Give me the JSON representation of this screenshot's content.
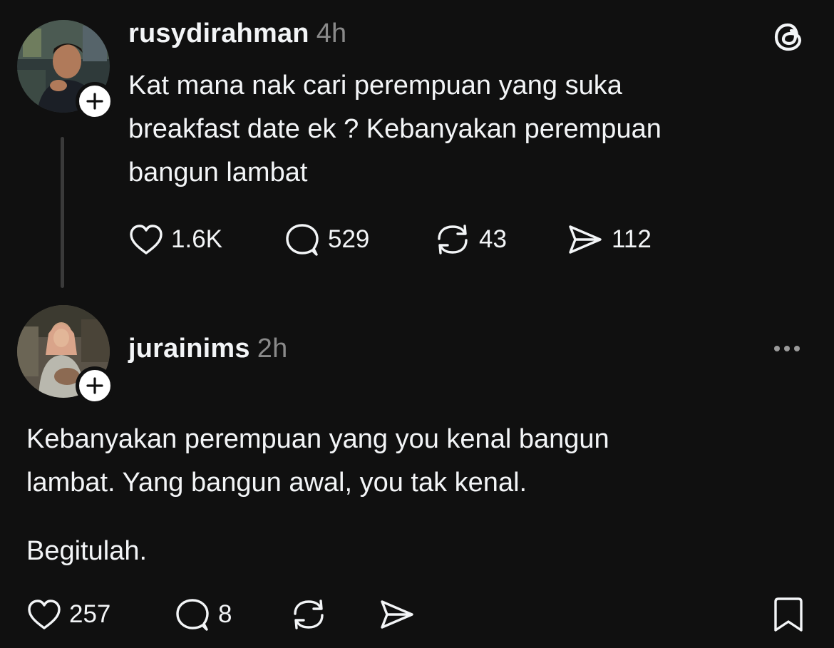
{
  "post1": {
    "username": "rusydirahman",
    "time": "4h",
    "text": "Kat mana nak cari perempuan yang suka\nbreakfast date ek ? Kebanyakan perempuan\nbangun lambat",
    "likes": "1.6K",
    "replies": "529",
    "reposts": "43",
    "shares": "112"
  },
  "post2": {
    "username": "jurainims",
    "time": "2h",
    "text": "Kebanyakan perempuan yang you kenal bangun\nlambat. Yang bangun awal, you tak kenal.",
    "text2": "Begitulah.",
    "likes": "257",
    "replies": "8"
  },
  "icons": {
    "logo": "threads-logo-icon",
    "like": "heart-icon",
    "reply": "comment-bubble-icon",
    "repost": "repost-icon",
    "share": "send-icon",
    "more": "more-dots-icon",
    "save": "bookmark-icon",
    "follow": "plus-icon"
  },
  "colors": {
    "background": "#101010",
    "text": "#f3f5f7",
    "muted": "#8a8a8a"
  }
}
